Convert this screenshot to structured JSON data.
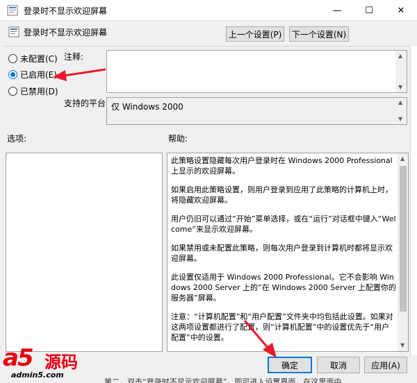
{
  "window": {
    "title": "登录时不显示欢迎屏幕",
    "minimize_glyph": "—",
    "maximize_glyph": "☐",
    "close_glyph": "✕"
  },
  "header": {
    "title": "登录时不显示欢迎屏幕",
    "prev_button": "上一个设置(P)",
    "next_button": "下一个设置(N)"
  },
  "radios": [
    {
      "label": "未配置(C)",
      "checked": false
    },
    {
      "label": "已启用(E)",
      "checked": true
    },
    {
      "label": "已禁用(D)",
      "checked": false
    }
  ],
  "labels": {
    "notes": "注释:",
    "platform": "支持的平台:",
    "options": "选项:",
    "help": "帮助:"
  },
  "notes_value": "",
  "platform_value": "仅 Windows 2000",
  "help_paragraphs": [
    "此策略设置隐藏每次用户登录时在 Windows 2000 Professional 上显示的欢迎屏幕。",
    "如果启用此策略设置，则用户登录到应用了此策略的计算机上时，将隐藏欢迎屏幕。",
    "用户仍旧可以通过“开始”菜单选择，或在“运行”对话框中键入“Welcome”来显示欢迎屏幕。",
    "如果禁用或未配置此策略，则每次用户登录到计算机时都将显示欢迎屏幕。",
    "此设置仅适用于 Windows 2000 Professional。它不会影响 Windows 2000 Server 上的“在 Windows 2000 Server 上配置你的服务器”屏幕。",
    "注意：“计算机配置”和“用户配置”文件夹中均包括此设置。如果对这两项设置都进行了配置，则“计算机配置”中的设置优先于“用户配置”中的设置。"
  ],
  "footer": {
    "ok": "确定",
    "cancel": "取消",
    "apply": "应用(A)"
  },
  "watermark": {
    "brand": "a5",
    "brand_cn": "源码",
    "url": "admin5.com"
  },
  "bottom_caption": "第二，双击“登录时不显示欢迎屏幕”，即可进入设置界面，在这里面中",
  "colors": {
    "accent": "#0078d7",
    "arrow": "#e8192c",
    "brand": "#e60012"
  }
}
